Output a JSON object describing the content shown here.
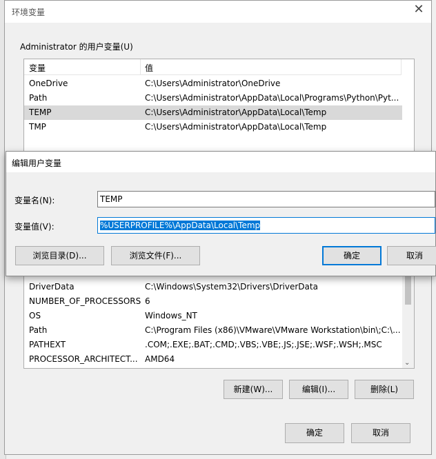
{
  "main_dialog": {
    "title": "环境变量",
    "user_group_label": "Administrator 的用户变量(U)",
    "user_columns": [
      "变量",
      "值"
    ],
    "user_vars": [
      {
        "name": "OneDrive",
        "value": "C:\\Users\\Administrator\\OneDrive"
      },
      {
        "name": "Path",
        "value": "C:\\Users\\Administrator\\AppData\\Local\\Programs\\Python\\Pyt..."
      },
      {
        "name": "TEMP",
        "value": "C:\\Users\\Administrator\\AppData\\Local\\Temp"
      },
      {
        "name": "TMP",
        "value": "C:\\Users\\Administrator\\AppData\\Local\\Temp"
      }
    ],
    "system_vars": [
      {
        "name": "DriverData",
        "value": "C:\\Windows\\System32\\Drivers\\DriverData"
      },
      {
        "name": "NUMBER_OF_PROCESSORS",
        "value": "6"
      },
      {
        "name": "OS",
        "value": "Windows_NT"
      },
      {
        "name": "Path",
        "value": "C:\\Program Files (x86)\\VMware\\VMware Workstation\\bin\\;C:\\..."
      },
      {
        "name": "PATHEXT",
        "value": ".COM;.EXE;.BAT;.CMD;.VBS;.VBE;.JS;.JSE;.WSF;.WSH;.MSC"
      },
      {
        "name": "PROCESSOR_ARCHITECT...",
        "value": "AMD64"
      }
    ],
    "system_buttons": {
      "new": "新建(W)...",
      "edit": "编辑(I)...",
      "delete": "删除(L)"
    },
    "ok": "确定",
    "cancel": "取消"
  },
  "edit_dialog": {
    "title": "编辑用户变量",
    "name_label": "变量名(N):",
    "name_value": "TEMP",
    "value_label": "变量值(V):",
    "value_value": "%USERPROFILE%\\AppData\\Local\\Temp",
    "browse_dir": "浏览目录(D)...",
    "browse_file": "浏览文件(F)...",
    "ok": "确定",
    "cancel": "取消"
  }
}
